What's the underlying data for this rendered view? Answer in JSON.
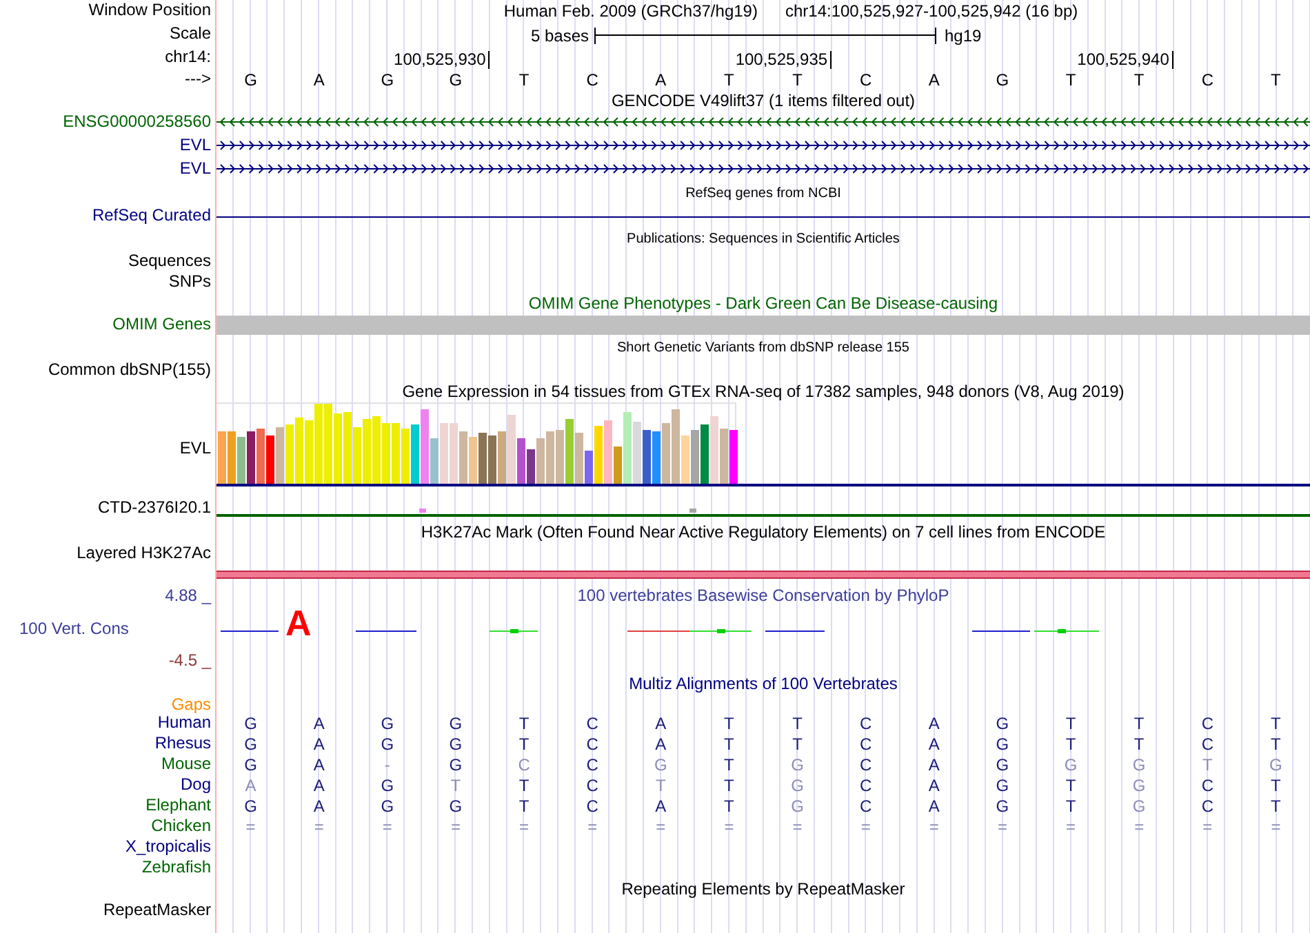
{
  "tracks": [
    {
      "kind": "position",
      "label": "Window Position",
      "assembly": "Human Feb. 2009 (GRCh37/hg19)",
      "range": "chr14:100,525,927-100,525,942 (16 bp)"
    },
    {
      "kind": "scale",
      "label": "Scale",
      "scale_text": "5 bases",
      "scale_db": "hg19"
    },
    {
      "kind": "ruler",
      "label": "chr14:",
      "ticks": [
        "100,525,930",
        "100,525,935",
        "100,525,940"
      ]
    },
    {
      "kind": "bases",
      "label": "--->",
      "bases": [
        "G",
        "A",
        "G",
        "G",
        "T",
        "C",
        "A",
        "T",
        "T",
        "C",
        "A",
        "G",
        "T",
        "T",
        "C",
        "T"
      ]
    },
    {
      "kind": "title",
      "text": "GENCODE V49lift37 (1 items filtered out)",
      "color": "#000000"
    },
    {
      "kind": "gene_minus",
      "label": "ENSG00000258560",
      "color": "#006400"
    },
    {
      "kind": "gene_plus",
      "label": "EVL",
      "color": "#000080"
    },
    {
      "kind": "gene_plus",
      "label": "EVL",
      "color": "#000080"
    },
    {
      "kind": "small_title",
      "text": "RefSeq genes from NCBI",
      "color": "#000000"
    },
    {
      "kind": "line",
      "label": "RefSeq Curated",
      "color": "#000080"
    },
    {
      "kind": "small_title",
      "text": "Publications: Sequences in Scientific Articles",
      "color": "#000000"
    },
    {
      "kind": "label_only",
      "label": "Sequences",
      "color": "#000000"
    },
    {
      "kind": "label_only",
      "label": "SNPs",
      "color": "#000000"
    },
    {
      "kind": "title",
      "text": "OMIM Gene Phenotypes - Dark Green Can Be Disease-causing",
      "color": "#006400"
    },
    {
      "kind": "gray_bar",
      "label": "OMIM Genes",
      "color": "#006400"
    },
    {
      "kind": "small_title",
      "text": "Short Genetic Variants from dbSNP release 155",
      "color": "#000000"
    },
    {
      "kind": "label_only",
      "label": "Common dbSNP(155)",
      "color": "#000000"
    },
    {
      "kind": "title",
      "text": "Gene Expression in 54 tissues from GTEx RNA-seq of 17382 samples, 948 donors (V8, Aug 2019)",
      "color": "#000000"
    },
    {
      "kind": "expression",
      "label": "EVL",
      "color": "#000000"
    },
    {
      "kind": "ctd",
      "label": "CTD-2376I20.1",
      "color": "#000000"
    },
    {
      "kind": "title",
      "text": "H3K27Ac Mark (Often Found Near Active Regulatory Elements) on 7 cell lines from ENCODE",
      "color": "#000000"
    },
    {
      "kind": "layered",
      "label": "Layered H3K27Ac",
      "color": "#000000"
    },
    {
      "kind": "phylop",
      "max_label": "4.88 _",
      "label": "100 Vert. Cons",
      "min_label": "-4.5 _",
      "text": "100 vertebrates Basewise Conservation by PhyloP",
      "logo_letter": "A",
      "color": "#3d3d9b"
    },
    {
      "kind": "title",
      "text": "Multiz Alignments of 100 Vertebrates",
      "color": "#000080"
    },
    {
      "kind": "gaps",
      "label": "Gaps",
      "color": "#ff8c00"
    },
    {
      "kind": "species",
      "label": "Human",
      "color": "#000080",
      "bases": [
        {
          "base": "G",
          "mismatch": false
        },
        {
          "base": "A",
          "mismatch": false
        },
        {
          "base": "G",
          "mismatch": false
        },
        {
          "base": "G",
          "mismatch": false
        },
        {
          "base": "T",
          "mismatch": false
        },
        {
          "base": "C",
          "mismatch": false
        },
        {
          "base": "A",
          "mismatch": false
        },
        {
          "base": "T",
          "mismatch": false
        },
        {
          "base": "T",
          "mismatch": false
        },
        {
          "base": "C",
          "mismatch": false
        },
        {
          "base": "A",
          "mismatch": false
        },
        {
          "base": "G",
          "mismatch": false
        },
        {
          "base": "T",
          "mismatch": false
        },
        {
          "base": "T",
          "mismatch": false
        },
        {
          "base": "C",
          "mismatch": false
        },
        {
          "base": "T",
          "mismatch": false
        }
      ]
    },
    {
      "kind": "species",
      "label": "Rhesus",
      "color": "#000080",
      "bases": [
        {
          "base": "G",
          "mismatch": false
        },
        {
          "base": "A",
          "mismatch": false
        },
        {
          "base": "G",
          "mismatch": false
        },
        {
          "base": "G",
          "mismatch": false
        },
        {
          "base": "T",
          "mismatch": false
        },
        {
          "base": "C",
          "mismatch": false
        },
        {
          "base": "A",
          "mismatch": false
        },
        {
          "base": "T",
          "mismatch": false
        },
        {
          "base": "T",
          "mismatch": false
        },
        {
          "base": "C",
          "mismatch": false
        },
        {
          "base": "A",
          "mismatch": false
        },
        {
          "base": "G",
          "mismatch": false
        },
        {
          "base": "T",
          "mismatch": false
        },
        {
          "base": "T",
          "mismatch": false
        },
        {
          "base": "C",
          "mismatch": false
        },
        {
          "base": "T",
          "mismatch": false
        }
      ]
    },
    {
      "kind": "species",
      "label": "Mouse",
      "color": "#006400",
      "bases": [
        {
          "base": "G",
          "mismatch": false
        },
        {
          "base": "A",
          "mismatch": false
        },
        {
          "base": "-",
          "mismatch": true
        },
        {
          "base": "G",
          "mismatch": false
        },
        {
          "base": "C",
          "mismatch": true
        },
        {
          "base": "C",
          "mismatch": false
        },
        {
          "base": "G",
          "mismatch": true
        },
        {
          "base": "T",
          "mismatch": false
        },
        {
          "base": "G",
          "mismatch": true
        },
        {
          "base": "C",
          "mismatch": false
        },
        {
          "base": "A",
          "mismatch": false
        },
        {
          "base": "G",
          "mismatch": false
        },
        {
          "base": "G",
          "mismatch": true
        },
        {
          "base": "G",
          "mismatch": true
        },
        {
          "base": "T",
          "mismatch": true
        },
        {
          "base": "G",
          "mismatch": true
        }
      ]
    },
    {
      "kind": "species",
      "label": "Dog",
      "color": "#000080",
      "bases": [
        {
          "base": "A",
          "mismatch": true
        },
        {
          "base": "A",
          "mismatch": false
        },
        {
          "base": "G",
          "mismatch": false
        },
        {
          "base": "T",
          "mismatch": true
        },
        {
          "base": "T",
          "mismatch": false
        },
        {
          "base": "C",
          "mismatch": false
        },
        {
          "base": "T",
          "mismatch": true
        },
        {
          "base": "T",
          "mismatch": false
        },
        {
          "base": "G",
          "mismatch": true
        },
        {
          "base": "C",
          "mismatch": false
        },
        {
          "base": "A",
          "mismatch": false
        },
        {
          "base": "G",
          "mismatch": false
        },
        {
          "base": "T",
          "mismatch": false
        },
        {
          "base": "G",
          "mismatch": true
        },
        {
          "base": "C",
          "mismatch": false
        },
        {
          "base": "T",
          "mismatch": false
        }
      ]
    },
    {
      "kind": "species",
      "label": "Elephant",
      "color": "#006400",
      "bases": [
        {
          "base": "G",
          "mismatch": false
        },
        {
          "base": "A",
          "mismatch": false
        },
        {
          "base": "G",
          "mismatch": false
        },
        {
          "base": "G",
          "mismatch": false
        },
        {
          "base": "T",
          "mismatch": false
        },
        {
          "base": "C",
          "mismatch": false
        },
        {
          "base": "A",
          "mismatch": false
        },
        {
          "base": "T",
          "mismatch": false
        },
        {
          "base": "G",
          "mismatch": true
        },
        {
          "base": "C",
          "mismatch": false
        },
        {
          "base": "A",
          "mismatch": false
        },
        {
          "base": "G",
          "mismatch": false
        },
        {
          "base": "T",
          "mismatch": false
        },
        {
          "base": "G",
          "mismatch": true
        },
        {
          "base": "C",
          "mismatch": false
        },
        {
          "base": "T",
          "mismatch": false
        }
      ]
    },
    {
      "kind": "species",
      "label": "Chicken",
      "color": "#006400",
      "bases": [
        {
          "base": "=",
          "mismatch": true
        },
        {
          "base": "=",
          "mismatch": true
        },
        {
          "base": "=",
          "mismatch": true
        },
        {
          "base": "=",
          "mismatch": true
        },
        {
          "base": "=",
          "mismatch": true
        },
        {
          "base": "=",
          "mismatch": true
        },
        {
          "base": "=",
          "mismatch": true
        },
        {
          "base": "=",
          "mismatch": true
        },
        {
          "base": "=",
          "mismatch": true
        },
        {
          "base": "=",
          "mismatch": true
        },
        {
          "base": "=",
          "mismatch": true
        },
        {
          "base": "=",
          "mismatch": true
        },
        {
          "base": "=",
          "mismatch": true
        },
        {
          "base": "=",
          "mismatch": true
        },
        {
          "base": "=",
          "mismatch": true
        },
        {
          "base": "=",
          "mismatch": true
        }
      ]
    },
    {
      "kind": "species",
      "label": "X_tropicalis",
      "color": "#000080"
    },
    {
      "kind": "species",
      "label": "Zebrafish",
      "color": "#006400"
    },
    {
      "kind": "title",
      "text": "Repeating Elements by RepeatMasker",
      "color": "#000000"
    },
    {
      "kind": "label_only",
      "label": "RepeatMasker",
      "color": "#000000"
    }
  ]
}
